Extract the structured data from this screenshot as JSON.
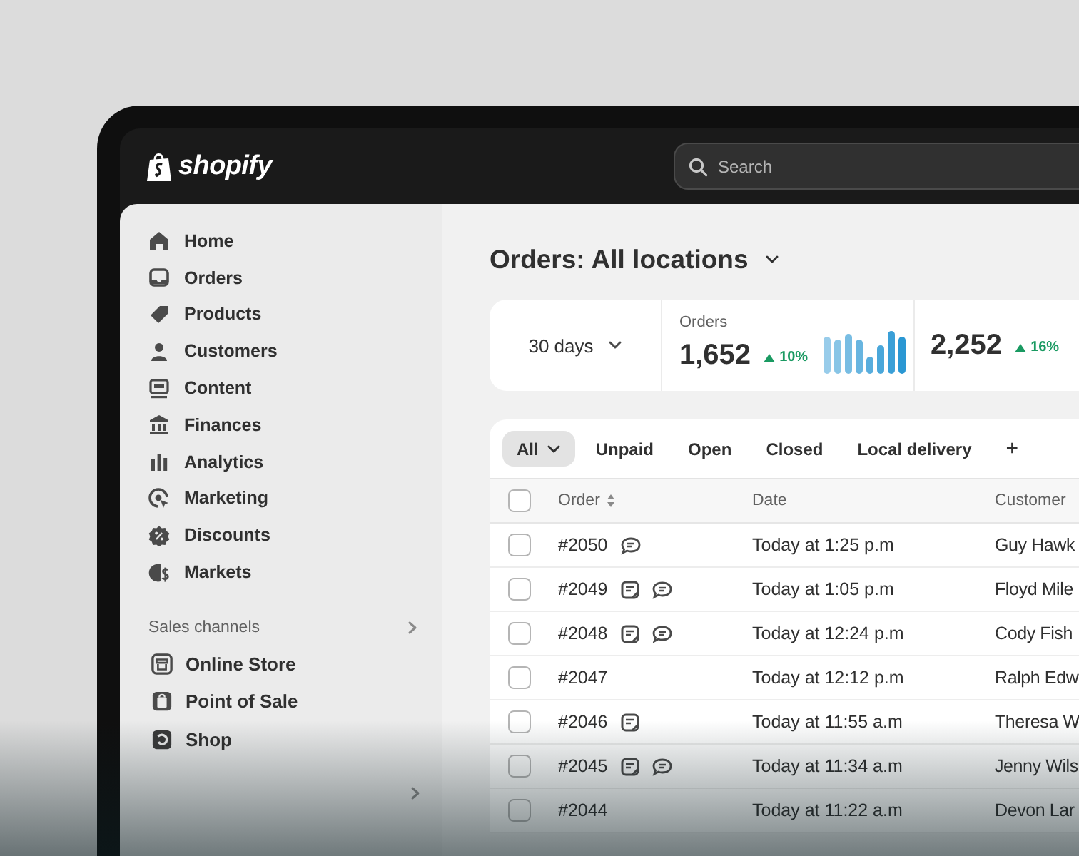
{
  "topbar": {
    "logo": "shopify",
    "search": {
      "placeholder": "Search"
    }
  },
  "sidebar": {
    "items": [
      {
        "label": "Home"
      },
      {
        "label": "Orders"
      },
      {
        "label": "Products"
      },
      {
        "label": "Customers"
      },
      {
        "label": "Content"
      },
      {
        "label": "Finances"
      },
      {
        "label": "Analytics"
      },
      {
        "label": "Marketing"
      },
      {
        "label": "Discounts"
      },
      {
        "label": "Markets"
      }
    ],
    "sales_channels": {
      "heading": "Sales channels",
      "items": [
        {
          "label": "Online Store"
        },
        {
          "label": "Point of Sale"
        },
        {
          "label": "Shop"
        }
      ]
    }
  },
  "page_title": "Orders: All locations",
  "metrics": {
    "period": "30 days",
    "cards": [
      {
        "label": "Orders",
        "value": "1,652",
        "change": "10%"
      },
      {
        "value": "2,252",
        "change": "16%"
      }
    ]
  },
  "filter_tabs": [
    {
      "label": "All",
      "selected": true
    },
    {
      "label": "Unpaid",
      "selected": false
    },
    {
      "label": "Open",
      "selected": false
    },
    {
      "label": "Closed",
      "selected": false
    },
    {
      "label": "Local delivery",
      "selected": false
    }
  ],
  "add_tab": "+",
  "table": {
    "header_checked": false,
    "columns": [
      "Order",
      "Date",
      "Customer"
    ],
    "rows": [
      {
        "checked": false,
        "order": "#2050",
        "note": false,
        "comment": true,
        "date": "Today at 1:25 p.m",
        "customer": "Guy Hawk"
      },
      {
        "checked": false,
        "order": "#2049",
        "note": true,
        "comment": true,
        "date": "Today at 1:05 p.m",
        "customer": "Floyd Mile"
      },
      {
        "checked": false,
        "order": "#2048",
        "note": true,
        "comment": true,
        "date": "Today at 12:24 p.m",
        "customer": "Cody Fish"
      },
      {
        "checked": false,
        "order": "#2047",
        "note": false,
        "comment": false,
        "date": "Today at 12:12 p.m",
        "customer": "Ralph Edw"
      },
      {
        "checked": false,
        "order": "#2046",
        "note": true,
        "comment": false,
        "date": "Today at 11:55 a.m",
        "customer": "Theresa W"
      },
      {
        "checked": false,
        "order": "#2045",
        "note": true,
        "comment": true,
        "date": "Today at 11:34 a.m",
        "customer": "Jenny Wils"
      },
      {
        "checked": false,
        "order": "#2044",
        "note": false,
        "comment": false,
        "date": "Today at 11:22 a.m",
        "customer": "Devon Lar"
      }
    ]
  }
}
